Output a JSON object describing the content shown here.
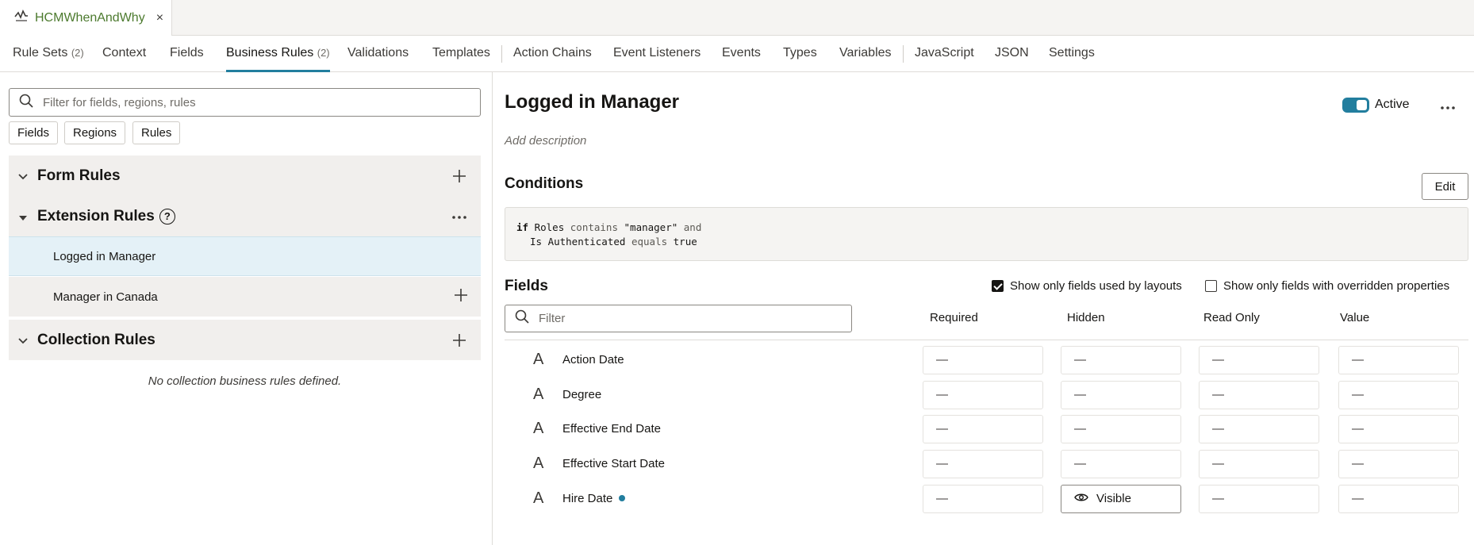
{
  "file_tab": {
    "label": "HCMWhenAndWhy",
    "close": "×"
  },
  "nav": {
    "tabs": [
      {
        "label": "Rule Sets",
        "count": "(2)"
      },
      {
        "label": "Context"
      },
      {
        "label": "Fields"
      },
      {
        "label": "Business Rules",
        "count": "(2)",
        "active": true
      },
      {
        "label": "Validations"
      },
      {
        "label": "Templates"
      },
      {
        "label": "Action Chains"
      },
      {
        "label": "Event Listeners"
      },
      {
        "label": "Events"
      },
      {
        "label": "Types"
      },
      {
        "label": "Variables"
      },
      {
        "label": "JavaScript"
      },
      {
        "label": "JSON"
      },
      {
        "label": "Settings"
      }
    ]
  },
  "left": {
    "search_placeholder": "Filter for fields, regions, rules",
    "chips": [
      "Fields",
      "Regions",
      "Rules"
    ],
    "form_rules": {
      "title": "Form Rules"
    },
    "extension_rules": {
      "title": "Extension Rules",
      "help": "?"
    },
    "rules": [
      {
        "label": "Logged in Manager"
      },
      {
        "label": "Manager in Canada"
      }
    ],
    "collection_rules": {
      "title": "Collection Rules",
      "empty": "No collection business rules defined."
    }
  },
  "detail": {
    "title": "Logged in Manager",
    "status": "Active",
    "status_on": true,
    "description_placeholder": "Add description",
    "conditions_title": "Conditions",
    "edit_label": "Edit",
    "condition": {
      "line1": {
        "kw": "if",
        "field": "Roles",
        "op": "contains",
        "value": "\"manager\"",
        "join": "and"
      },
      "line2": {
        "field": "Is Authenticated",
        "op": "equals",
        "value": "true"
      }
    },
    "fields_title": "Fields",
    "show_used_label": "Show only fields used by layouts",
    "show_used_checked": true,
    "show_overridden_label": "Show only fields with overridden properties",
    "show_overridden_checked": false,
    "filter_placeholder": "Filter",
    "columns": [
      "Required",
      "Hidden",
      "Read Only",
      "Value"
    ],
    "rows": [
      {
        "name": "Action Date",
        "required": "—",
        "hidden": "—",
        "read_only": "—",
        "value": "—"
      },
      {
        "name": "Degree",
        "required": "—",
        "hidden": "—",
        "read_only": "—",
        "value": "—"
      },
      {
        "name": "Effective End Date",
        "required": "—",
        "hidden": "—",
        "read_only": "—",
        "value": "—"
      },
      {
        "name": "Effective Start Date",
        "required": "—",
        "hidden": "—",
        "read_only": "—",
        "value": "—"
      },
      {
        "name": "Hire Date",
        "modified": true,
        "required": "—",
        "hidden": "Visible",
        "read_only": "—",
        "value": "—"
      }
    ]
  },
  "icons": {
    "file_tab": "rule-set-icon",
    "search": "search-icon",
    "field_type": "text-field-icon",
    "visible": "eye-icon"
  },
  "colors": {
    "accent": "#227e9e",
    "file_tab_text": "#4c7a2e",
    "selected_row": "#e4f1f7"
  }
}
